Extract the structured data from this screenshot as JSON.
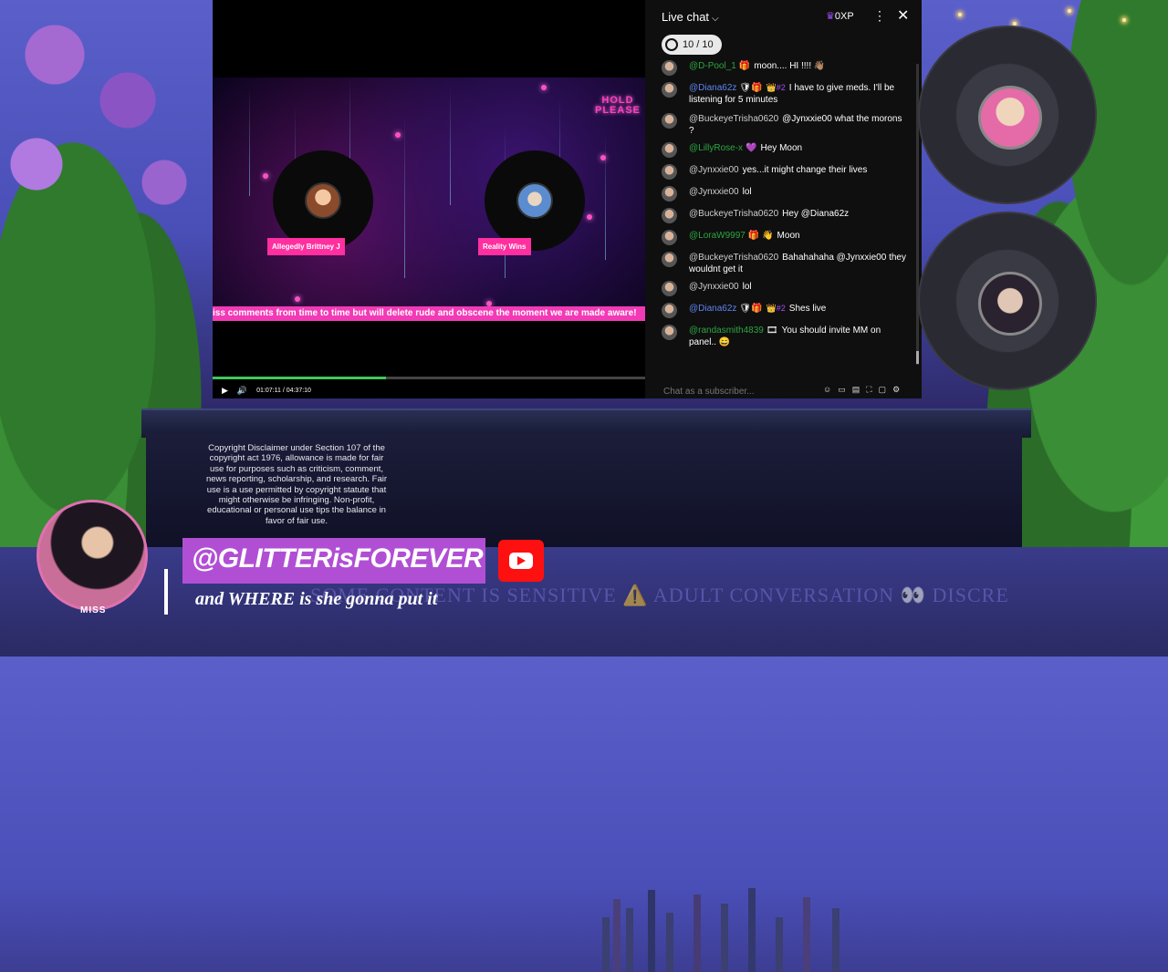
{
  "player": {
    "hold_please": "HOLD\nPLEASE",
    "guests": [
      {
        "label": "Allegedly Brittney J"
      },
      {
        "label": "Reality Wins"
      }
    ],
    "ticker_text": "iss comments from time to time but will delete rude and obscene the moment we are made aware!",
    "time": "01:07:11 / 04:37:10",
    "progress_fraction": 0.4
  },
  "chat": {
    "title": "Live chat",
    "xp": "0XP",
    "goal": "10 / 10",
    "input_placeholder": "Chat as a subscriber...",
    "messages": [
      {
        "author": "@D-Pool_1",
        "author_color": "green",
        "emoji": "🎁",
        "text": "moon.... HI !!!! 👋🏽"
      },
      {
        "author": "@Diana62z",
        "author_color": "mod",
        "emoji": "🛡🎁",
        "rank": "👑#2",
        "text": "I have to give meds. I'll be listening for 5 minutes"
      },
      {
        "author": "@BuckeyeTrisha0620",
        "author_color": "plain",
        "emoji": "",
        "text": "@Jynxxie00 what the morons ?"
      },
      {
        "author": "@LillyRose-x",
        "author_color": "green",
        "emoji": "💜",
        "text": "Hey Moon"
      },
      {
        "author": "@Jynxxie00",
        "author_color": "plain",
        "emoji": "",
        "text": "yes...it might change their lives"
      },
      {
        "author": "@Jynxxie00",
        "author_color": "plain",
        "emoji": "",
        "text": "lol"
      },
      {
        "author": "@BuckeyeTrisha0620",
        "author_color": "plain",
        "emoji": "",
        "text": "Hey @Diana62z"
      },
      {
        "author": "@LoraW9997",
        "author_color": "green",
        "emoji": "🎁 👋",
        "text": "Moon"
      },
      {
        "author": "@BuckeyeTrisha0620",
        "author_color": "plain",
        "emoji": "",
        "text": "Bahahahaha @Jynxxie00 they wouldnt get it"
      },
      {
        "author": "@Jynxxie00",
        "author_color": "plain",
        "emoji": "",
        "text": "lol"
      },
      {
        "author": "@Diana62z",
        "author_color": "mod",
        "emoji": "🛡🎁",
        "rank": "👑#2",
        "text": "Shes live"
      },
      {
        "author": "@randasmith4839",
        "author_color": "green",
        "emoji": "🎞",
        "text": "You should invite MM on panel.. 😄"
      }
    ]
  },
  "overlay": {
    "disclaimer": "Copyright Disclaimer under Section 107 of the copyright act 1976, allowance is made for fair use for purposes such as criticism, comment, news reporting, scholarship, and research. Fair use is a use permitted by copyright statute that might otherwise be infringing. Non-profit, educational or personal use tips the balance in favor of fair use.",
    "marquee": "SOME CONTENT IS SENSITIVE ⚠️ ADULT CONVERSATION 👀 DISCRE",
    "host_label": "MISS",
    "handle": "@GLITTERisFOREVER",
    "caption": "and WHERE is she gonna put it"
  }
}
